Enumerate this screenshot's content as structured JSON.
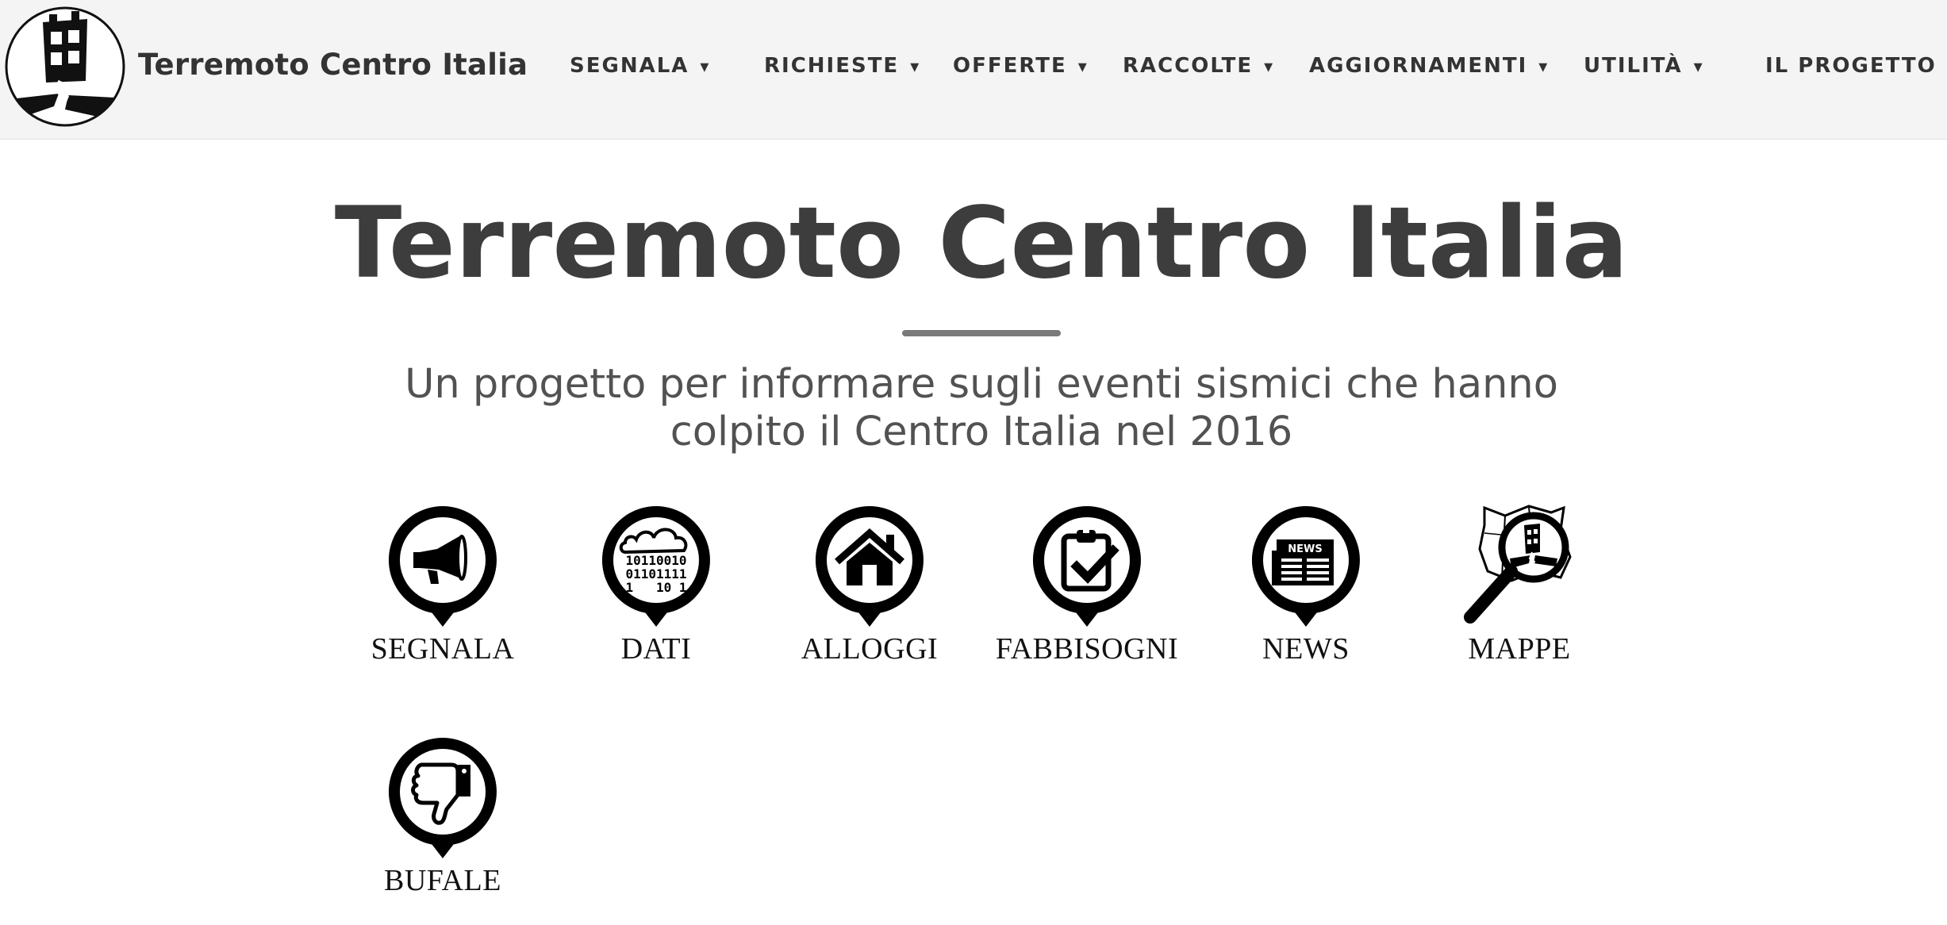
{
  "navbar": {
    "brand": "Terremoto Centro Italia",
    "menu": [
      {
        "label": "SEGNALA",
        "caret": "▾"
      },
      {
        "label": "RICHIESTE",
        "caret": "▾"
      },
      {
        "label": "OFFERTE",
        "caret": "▾"
      },
      {
        "label": "RACCOLTE",
        "caret": "▾"
      },
      {
        "label": "AGGIORNAMENTI",
        "caret": "▾"
      },
      {
        "label": "UTILITÀ",
        "caret": "▾"
      },
      {
        "label": "IL PROGETTO",
        "caret": "▾"
      }
    ]
  },
  "hero": {
    "title": "Terremoto Centro Italia",
    "subtitle_line1": "Un progetto per informare sugli eventi sismici che hanno",
    "subtitle_line2": "colpito il Centro Italia nel 2016"
  },
  "categories": [
    {
      "label": "SEGNALA",
      "icon": "megaphone-icon"
    },
    {
      "label": "DATI",
      "icon": "data-cloud-icon"
    },
    {
      "label": "ALLOGGI",
      "icon": "house-icon"
    },
    {
      "label": "FABBISOGNI",
      "icon": "clipboard-check-icon"
    },
    {
      "label": "NEWS",
      "icon": "newspaper-icon",
      "icon_text": "NEWS"
    },
    {
      "label": "MAPPE",
      "icon": "map-magnifier-icon"
    },
    {
      "label": "BUFALE",
      "icon": "thumbs-down-icon"
    }
  ],
  "data_icon_text": {
    "row1": "10110010",
    "row2": "01101111",
    "row3": "1   10 1"
  },
  "colors": {
    "navbar_bg": "#f4f4f4",
    "title_text": "#3d3d3d",
    "icon_black": "#000000"
  }
}
